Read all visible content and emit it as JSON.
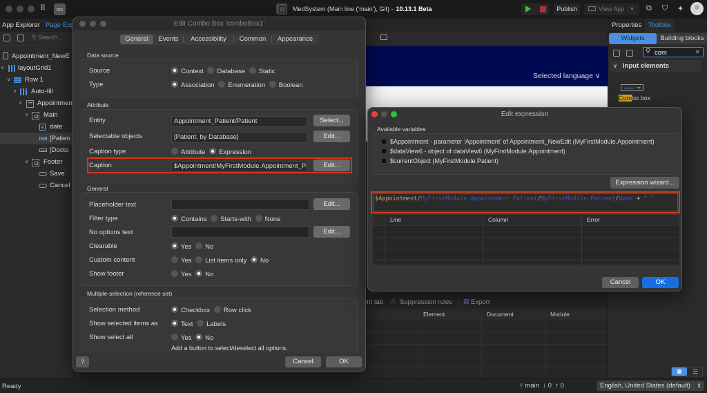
{
  "titlebar": {
    "app_title": "MedSystem (Main line ('main'), Git) -",
    "version": "10.13.1 Beta",
    "logo": "mx",
    "publish_label": "Publish",
    "view_app_label": "View App"
  },
  "left_panel": {
    "tabs": [
      "App Explorer",
      "Page Exp"
    ],
    "search_placeholder": "Search...",
    "tree": [
      {
        "label": "Appointment_NewE",
        "icon": "page-icon"
      },
      {
        "label": "layoutGrid1",
        "icon": "layout-grid-icon"
      },
      {
        "label": "Row 1",
        "icon": "row-icon"
      },
      {
        "label": "Auto-fill",
        "icon": "column-icon"
      },
      {
        "label": "Appointmen",
        "icon": "dataview-icon"
      },
      {
        "label": "Main",
        "icon": "container-icon"
      },
      {
        "label": "date",
        "icon": "date-picker-icon"
      },
      {
        "label": "[Patien",
        "icon": "combo-box-icon",
        "selected": true
      },
      {
        "label": "[Docto",
        "icon": "combo-box-icon"
      },
      {
        "label": "Footer",
        "icon": "container-icon"
      },
      {
        "label": "Save",
        "icon": "button-icon"
      },
      {
        "label": "Cancel",
        "icon": "button-icon"
      }
    ]
  },
  "canvas": {
    "language_selector": "Selected language",
    "error_toolbar": {
      "partial_tab": "ent tab",
      "suppression": "Suppression rules",
      "export": "Export"
    },
    "error_columns": [
      "Element",
      "Document",
      "Module"
    ]
  },
  "right_panel": {
    "tabs": [
      "Properties",
      "Toolbox"
    ],
    "active_tab": "Toolbox",
    "segments": [
      "Widgets",
      "Building blocks"
    ],
    "search_value": "com",
    "section": "Input elements",
    "widget_label_highlight": "Com",
    "widget_label_rest": "bo box"
  },
  "statusbar": {
    "status": "Ready",
    "branch": "main",
    "incoming": "0",
    "outgoing": "0",
    "language": "English, United States (default)"
  },
  "combo_dialog": {
    "title": "Edit Combo Box 'comboBox1'",
    "tabs": [
      "General",
      "Events",
      "Accessibility",
      "Common",
      "Appearance"
    ],
    "active_tab": "General",
    "groups": {
      "data_source": "Data source",
      "attribute": "Attribute",
      "general": "General",
      "multi": "Multiple-selection (reference set)"
    },
    "source": {
      "label": "Source",
      "options": [
        "Context",
        "Database",
        "Static"
      ],
      "selected": "Context"
    },
    "type": {
      "label": "Type",
      "options": [
        "Association",
        "Enumeration",
        "Boolean"
      ],
      "selected": "Association"
    },
    "entity": {
      "label": "Entity",
      "value": "Appointment_Patient/Patient",
      "button": "Select..."
    },
    "selectable_objects": {
      "label": "Selectable objects",
      "value": "[Patient, by Database]",
      "button": "Edit..."
    },
    "caption_type": {
      "label": "Caption type",
      "options": [
        "Attribute",
        "Expression"
      ],
      "selected": "Expression"
    },
    "caption": {
      "label": "Caption",
      "value": "$Appointment/MyFirstModule.Appointment_Patient/MyFirstModule.Patient/Name + ' '",
      "button": "Edit..."
    },
    "placeholder_text": {
      "label": "Placeholder text",
      "value": "",
      "button": "Edit..."
    },
    "filter_type": {
      "label": "Filter type",
      "options": [
        "Contains",
        "Starts-with",
        "None"
      ],
      "selected": "Contains"
    },
    "no_options_text": {
      "label": "No options text",
      "value": "",
      "button": "Edit..."
    },
    "clearable": {
      "label": "Clearable",
      "options": [
        "Yes",
        "No"
      ],
      "selected": "Yes"
    },
    "custom_content": {
      "label": "Custom content",
      "options": [
        "Yes",
        "List items only",
        "No"
      ],
      "selected": "No"
    },
    "show_footer": {
      "label": "Show footer",
      "options": [
        "Yes",
        "No"
      ],
      "selected": "No"
    },
    "selection_method": {
      "label": "Selection method",
      "options": [
        "Checkbox",
        "Row click"
      ],
      "selected": "Checkbox"
    },
    "show_selected_as": {
      "label": "Show selected items as",
      "options": [
        "Text",
        "Labels"
      ],
      "selected": "Text"
    },
    "show_select_all": {
      "label": "Show select all",
      "options": [
        "Yes",
        "No"
      ],
      "selected": "No"
    },
    "select_all_hint": "Add a button to select/deselect all options.",
    "help_label": "?",
    "cancel_label": "Cancel",
    "ok_label": "OK"
  },
  "expr_dialog": {
    "title": "Edit expression",
    "vars_label": "Available variables",
    "variables": [
      "$Appointment - parameter 'Appointment' of Appointment_NewEdit (MyFirstModule.Appointment)",
      "$dataView6 - object of dataView6 (MyFirstModule.Appointment)",
      "$currentObject (MyFirstModule.Patient)"
    ],
    "wizard_label": "Expression wizard...",
    "expression_tokens": {
      "var": "$Appointment",
      "assoc": "MyFirstModule.Appointment_Patient",
      "entity": "MyFirstModule.Patient",
      "attr": "Name",
      "op": "+",
      "str": "' '"
    },
    "error_columns": [
      "Line",
      "Column",
      "Error"
    ],
    "cancel_label": "Cancel",
    "ok_label": "OK"
  },
  "colors": {
    "accent": "#4a8fe0",
    "ok_button": "#1a6fe0",
    "highlight_border": "#d13a1a",
    "page_header": "#000a52"
  }
}
